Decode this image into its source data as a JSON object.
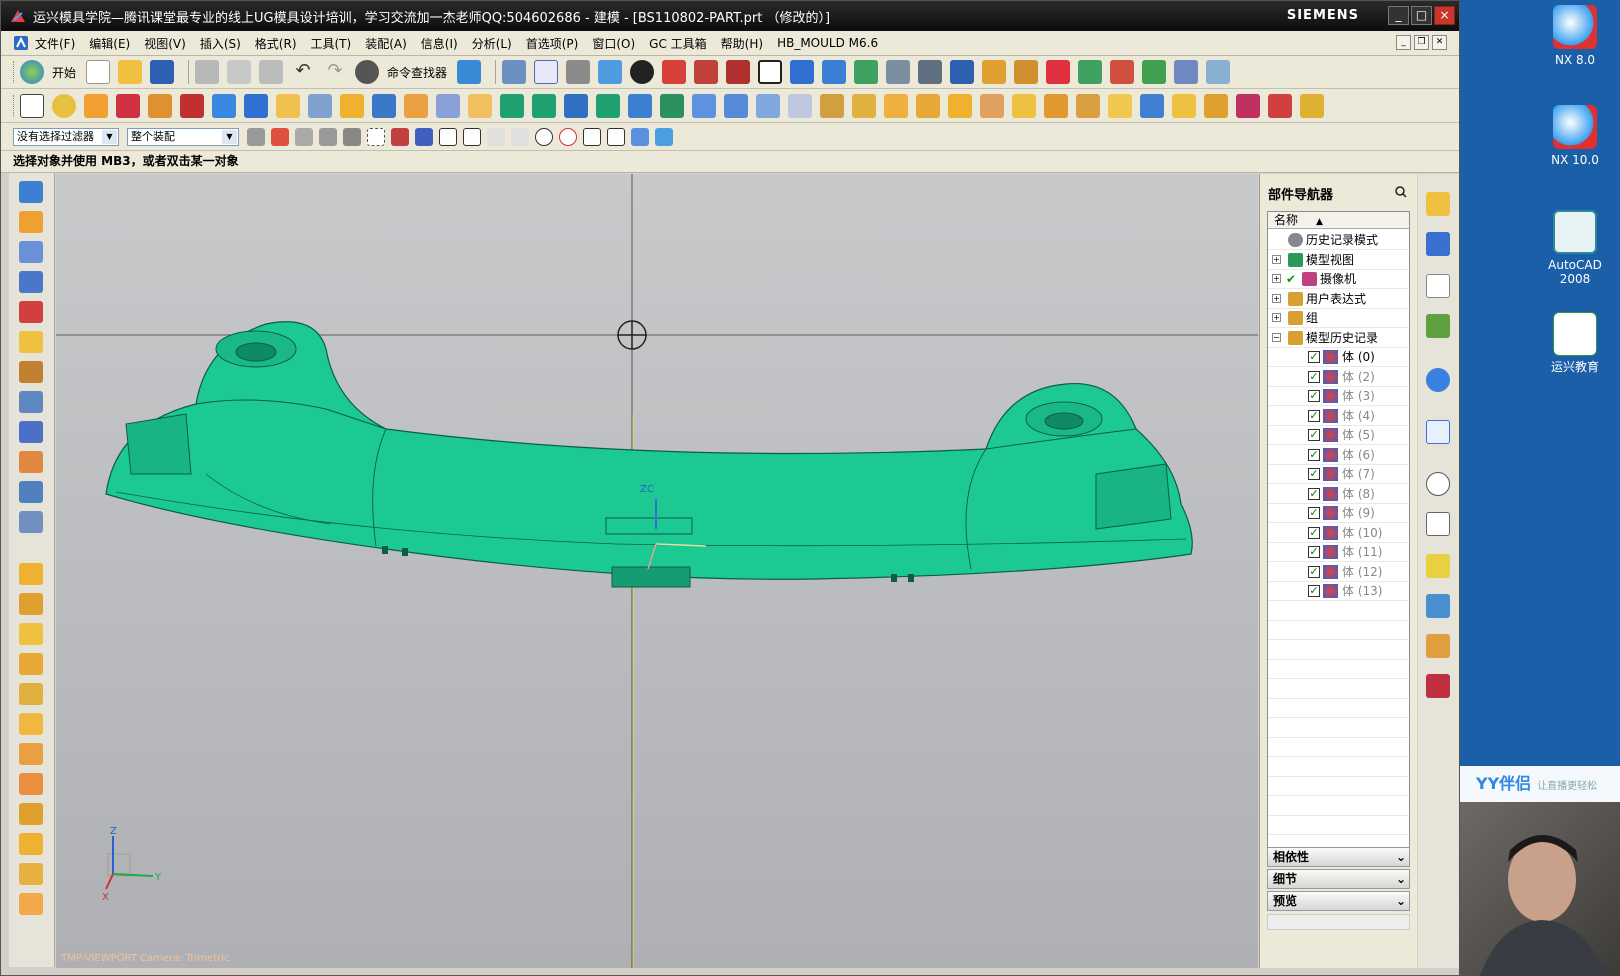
{
  "window": {
    "title": "运兴模具学院—腾讯课堂最专业的线上UG模具设计培训，学习交流加一杰老师QQ:504602686 - 建模 - [BS110802-PART.prt （修改的）]",
    "brand": "SIEMENS",
    "buttons": [
      "_",
      "□",
      "×"
    ]
  },
  "menubar": {
    "items": [
      "文件(F)",
      "编辑(E)",
      "视图(V)",
      "插入(S)",
      "格式(R)",
      "工具(T)",
      "装配(A)",
      "信息(I)",
      "分析(L)",
      "首选项(P)",
      "窗口(O)",
      "GC 工具箱",
      "帮助(H)",
      "HB_MOULD M6.6"
    ]
  },
  "toolbar1": {
    "start_label": "开始",
    "command_finder": "命令查找器"
  },
  "selection_bar": {
    "filter": "没有选择过滤器",
    "scope": "整个装配"
  },
  "status": {
    "prompt": "选择对象并使用 MB3，或者双击某一对象"
  },
  "viewport": {
    "wcs_label": "ZC",
    "csys_z": "Z",
    "csys_y": "Y",
    "csys_x": "X",
    "corner_text": "TMP-VIEWPORT Camera: Trimetric",
    "model_color": "#1cc993"
  },
  "navigator": {
    "title": "部件导航器",
    "column_name": "名称",
    "nodes": [
      {
        "label": "历史记录模式",
        "expander": ""
      },
      {
        "label": "模型视图",
        "expander": "+"
      },
      {
        "label": "摄像机",
        "expander": "+"
      },
      {
        "label": "用户表达式",
        "expander": "+"
      },
      {
        "label": "组",
        "expander": "+"
      },
      {
        "label": "模型历史记录",
        "expander": "−"
      }
    ],
    "bodies": [
      "体 (0)",
      "体 (2)",
      "体 (3)",
      "体 (4)",
      "体 (5)",
      "体 (6)",
      "体 (7)",
      "体 (8)",
      "体 (9)",
      "体 (10)",
      "体 (11)",
      "体 (12)",
      "体 (13)"
    ],
    "sections": [
      "相依性",
      "细节",
      "预览"
    ]
  },
  "desktop": {
    "icons": [
      "NX 8.0",
      "NX 10.0",
      "AutoCAD 2008",
      "运兴教育"
    ],
    "yy_label": "YY伴侣",
    "yy_slogan": "让直播更轻松"
  }
}
